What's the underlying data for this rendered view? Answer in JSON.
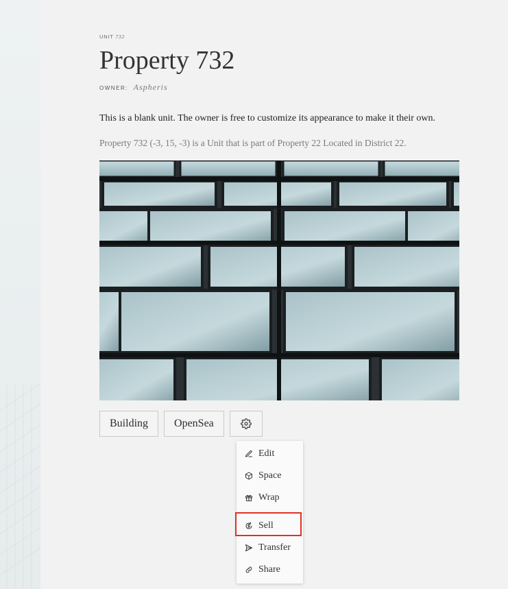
{
  "unit_label": {
    "prefix": "UNIT",
    "number": "732"
  },
  "title": "Property 732",
  "owner": {
    "label": "OWNER:",
    "name": "Aspheris"
  },
  "description": "This is a blank unit. The owner is free to customize its appearance to make it their own.",
  "subdescription": "Property 732 (-3, 15, -3) is a Unit that is part of Property 22 Located in District 22.",
  "buttons": {
    "building": "Building",
    "opensea": "OpenSea"
  },
  "menu": {
    "items": [
      {
        "label": "Edit",
        "icon": "pencil-icon"
      },
      {
        "label": "Space",
        "icon": "cube-icon"
      },
      {
        "label": "Wrap",
        "icon": "gift-icon"
      },
      {
        "label": "Sell",
        "icon": "currency-icon"
      },
      {
        "label": "Transfer",
        "icon": "send-icon"
      },
      {
        "label": "Share",
        "icon": "link-icon"
      }
    ]
  },
  "colors": {
    "background": "#f2f2f2",
    "highlight": "#e03024",
    "text": "#2d2d2d"
  }
}
